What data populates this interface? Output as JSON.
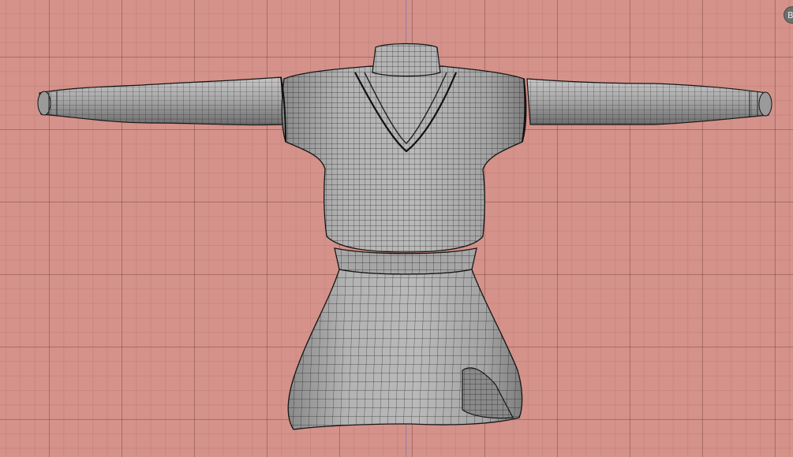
{
  "viewport": {
    "background_color": "#d4928a",
    "grid_color": "#8a4a4a",
    "axis_color": "#7f7fb8"
  },
  "model": {
    "type": "wireframe-mesh",
    "subject": "sweater-dress",
    "fill_color": "#a7a7a7",
    "wire_color": "#1a1a1a"
  },
  "gizmo": {
    "icon": "navigation-gizmo-icon",
    "label": "B"
  }
}
